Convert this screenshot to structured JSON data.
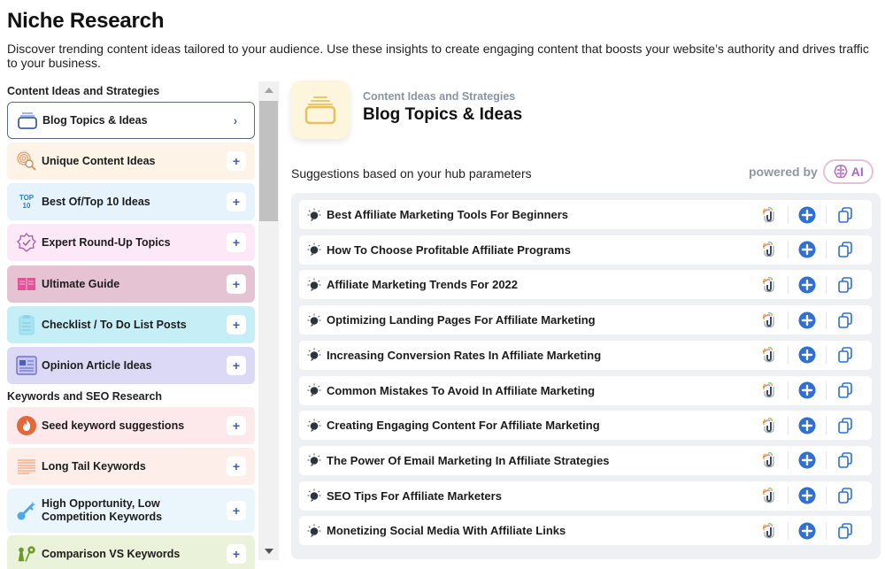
{
  "header": {
    "title": "Niche Research",
    "description": "Discover trending content ideas tailored to your audience. Use these insights to create engaging content that boosts your website’s authority and drives traffic to your business."
  },
  "sidebar": {
    "sections": [
      {
        "heading": "Content Ideas and Strategies",
        "items": [
          {
            "label": "Blog Topics & Ideas",
            "icon": "folder-stack-icon",
            "bg": "#ffffff",
            "active": true,
            "action": "›"
          },
          {
            "label": "Unique Content Ideas",
            "icon": "fingerprint-search-icon",
            "bg": "#fdf3e6",
            "action": "+"
          },
          {
            "label": "Best Of/Top 10 Ideas",
            "icon": "top-10-icon",
            "bg": "#e6f3fc",
            "action": "+"
          },
          {
            "label": "Expert Round-Up Topics",
            "icon": "badge-check-icon",
            "bg": "#fce8f6",
            "action": "+"
          },
          {
            "label": "Ultimate Guide",
            "icon": "open-book-icon",
            "bg": "#e6c3d3",
            "action": "+"
          },
          {
            "label": "Checklist / To Do List Posts",
            "icon": "clipboard-list-icon",
            "bg": "#c6eef6",
            "action": "+"
          },
          {
            "label": "Opinion Article Ideas",
            "icon": "newspaper-icon",
            "bg": "#dcd9f6",
            "action": "+"
          }
        ]
      },
      {
        "heading": "Keywords and SEO Research",
        "items": [
          {
            "label": "Seed keyword suggestions",
            "icon": "flame-icon",
            "bg": "#fde8ec",
            "action": "+"
          },
          {
            "label": "Long Tail Keywords",
            "icon": "lines-icon",
            "bg": "#fdeee9",
            "action": "+"
          },
          {
            "label": "High Opportunity, Low Competition Keywords",
            "icon": "key-icon",
            "bg": "#eaf5fc",
            "action": "+"
          },
          {
            "label": "Comparison VS Keywords",
            "icon": "pin-compare-icon",
            "bg": "#eaf2d9",
            "action": "+"
          }
        ]
      }
    ]
  },
  "main": {
    "category": "Content Ideas and Strategies",
    "title": "Blog Topics & Ideas",
    "suggestions_label": "Suggestions based on your hub parameters",
    "powered_by": "powered by",
    "ai_label": "AI",
    "suggestions": [
      "Best Affiliate Marketing Tools For Beginners",
      "How To Choose Profitable Affiliate Programs",
      "Affiliate Marketing Trends For 2022",
      "Optimizing Landing Pages For Affiliate Marketing",
      "Increasing Conversion Rates In Affiliate Marketing",
      "Common Mistakes To Avoid In Affiliate Marketing",
      "Creating Engaging Content For Affiliate Marketing",
      "The Power Of Email Marketing In Affiliate Strategies",
      "SEO Tips For Affiliate Marketers",
      "Monetizing Social Media With Affiliate Links"
    ],
    "row_actions": [
      "magnet-icon",
      "add-circle-icon",
      "copy-icon"
    ]
  },
  "colors": {
    "accent_blue": "#2f6fd6",
    "active_border": "#5a6c8a"
  }
}
